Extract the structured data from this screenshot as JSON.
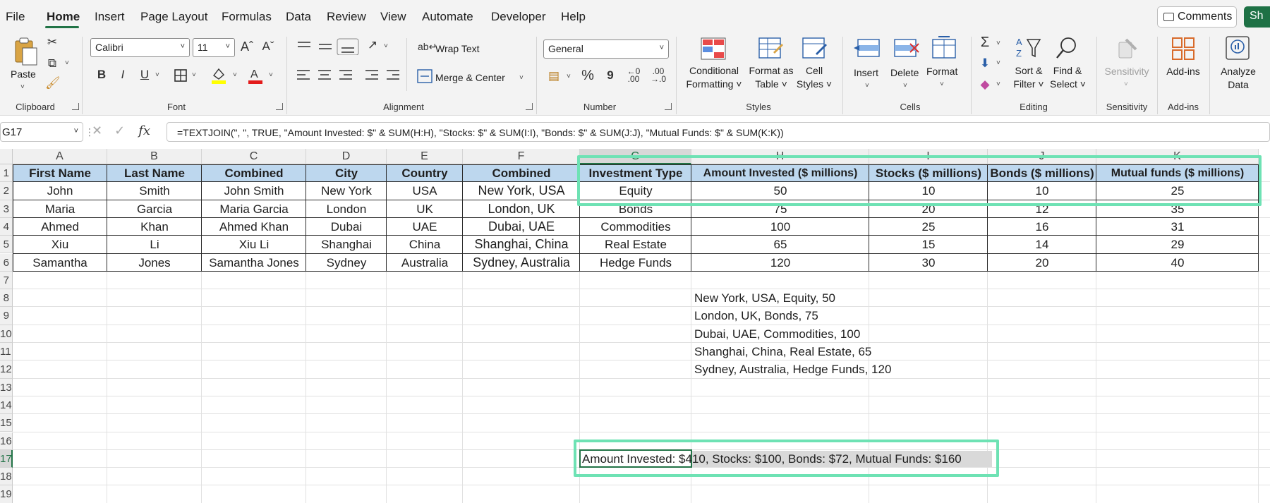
{
  "menu": {
    "tabs": [
      "File",
      "Home",
      "Insert",
      "Page Layout",
      "Formulas",
      "Data",
      "Review",
      "View",
      "Automate",
      "Developer",
      "Help"
    ],
    "active_tab": "Home",
    "comments_label": "Comments",
    "share_label": "Sh"
  },
  "ribbon": {
    "clipboard": {
      "paste": "Paste",
      "group": "Clipboard"
    },
    "font": {
      "name": "Calibri",
      "size": "11",
      "bold": "B",
      "italic": "I",
      "underline": "U",
      "grow": "A^",
      "shrink": "A˅",
      "group": "Font"
    },
    "alignment": {
      "wrap_text": "Wrap Text",
      "merge_center": "Merge & Center",
      "group": "Alignment"
    },
    "number": {
      "format": "General",
      "percent": "%",
      "comma": "9",
      "inc_dec": ".00",
      "dec_dec": ".0",
      "group": "Number"
    },
    "styles": {
      "conditional": [
        "Conditional",
        "Formatting"
      ],
      "format_table": [
        "Format as",
        "Table"
      ],
      "cell_styles": [
        "Cell",
        "Styles"
      ],
      "group": "Styles"
    },
    "cells": {
      "insert": "Insert",
      "delete": "Delete",
      "format": "Format",
      "group": "Cells"
    },
    "editing": {
      "sort_filter": [
        "Sort &",
        "Filter"
      ],
      "find_select": [
        "Find &",
        "Select"
      ],
      "group": "Editing"
    },
    "sensitivity": {
      "label": "Sensitivity",
      "group": "Sensitivity"
    },
    "addins": {
      "label": "Add-ins",
      "group": "Add-ins"
    },
    "analyze": {
      "label": [
        "Analyze",
        "Data"
      ]
    }
  },
  "formula_bar": {
    "name_box": "G17",
    "fx": "fx",
    "formula": "=TEXTJOIN(\", \", TRUE, \"Amount Invested: $\" & SUM(H:H), \"Stocks: $\" & SUM(I:I), \"Bonds: $\" & SUM(J:J), \"Mutual Funds: $\" & SUM(K:K))"
  },
  "grid": {
    "columns": [
      "A",
      "B",
      "C",
      "D",
      "E",
      "F",
      "G",
      "H",
      "I",
      "J",
      "K"
    ],
    "rows": [
      "1",
      "2",
      "3",
      "4",
      "5",
      "6",
      "7",
      "8",
      "9",
      "10",
      "11",
      "12",
      "13",
      "14",
      "15",
      "16",
      "17",
      "18",
      "19"
    ],
    "headers": [
      "First Name",
      "Last Name",
      "Combined",
      "City",
      "Country",
      "Combined",
      "Investment Type",
      "Amount Invested ($ millions)",
      "Stocks ($ millions)",
      "Bonds ($ millions)",
      "Mutual funds ($ millions)"
    ],
    "data": [
      [
        "John",
        "Smith",
        "John Smith",
        "New York",
        "USA",
        "New York, USA",
        "Equity",
        "50",
        "10",
        "10",
        "25"
      ],
      [
        "Maria",
        "Garcia",
        "Maria Garcia",
        "London",
        "UK",
        "London, UK",
        "Bonds",
        "75",
        "20",
        "12",
        "35"
      ],
      [
        "Ahmed",
        "Khan",
        "Ahmed Khan",
        "Dubai",
        "UAE",
        "Dubai, UAE",
        "Commodities",
        "100",
        "25",
        "16",
        "31"
      ],
      [
        "Xiu",
        "Li",
        "Xiu Li",
        "Shanghai",
        "China",
        "Shanghai, China",
        "Real Estate",
        "65",
        "15",
        "14",
        "29"
      ],
      [
        "Samantha",
        "Jones",
        "Samantha Jones",
        "Sydney",
        "Australia",
        "Sydney, Australia",
        "Hedge Funds",
        "120",
        "30",
        "20",
        "40"
      ]
    ],
    "joined": [
      "New York, USA, Equity, 50",
      "London, UK, Bonds, 75",
      "Dubai, UAE, Commodities, 100",
      "Shanghai, China, Real Estate, 65",
      "Sydney, Australia, Hedge Funds, 120"
    ],
    "summary": "Amount Invested: $410, Stocks: $100, Bonds: $72, Mutual Funds: $160"
  }
}
